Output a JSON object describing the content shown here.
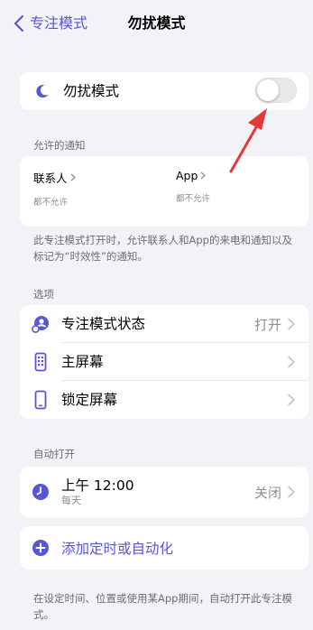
{
  "navbar": {
    "back_label": "专注模式",
    "title": "勿扰模式"
  },
  "mode_card": {
    "label": "勿扰模式",
    "toggle_on": false,
    "icon": "moon-icon"
  },
  "allowed": {
    "header": "允许的通知",
    "people": {
      "label": "联系人",
      "status": "都不允许"
    },
    "apps": {
      "label": "App",
      "status": "都不允许"
    },
    "footnote": "此专注模式打开时，允许联系人和App的来电和通知以及标记为“时效性”的通知。"
  },
  "options": {
    "header": "选项",
    "items": [
      {
        "label": "专注模式状态",
        "value": "打开",
        "icon": "focus-status-icon"
      },
      {
        "label": "主屏幕",
        "value": "",
        "icon": "home-screen-icon"
      },
      {
        "label": "锁定屏幕",
        "value": "",
        "icon": "lock-screen-icon"
      }
    ]
  },
  "auto": {
    "header": "自动打开",
    "schedule": {
      "time": "上午 12:00",
      "repeat": "每天",
      "value": "关闭",
      "icon": "clock-icon"
    },
    "add_label": "添加定时或自动化",
    "footnote": "在设定时间、位置或使用某App期间，自动打开此专注模式。"
  },
  "colors": {
    "accent": "#5856d6",
    "background": "#f2f2f7",
    "arrow": "#e53935"
  }
}
